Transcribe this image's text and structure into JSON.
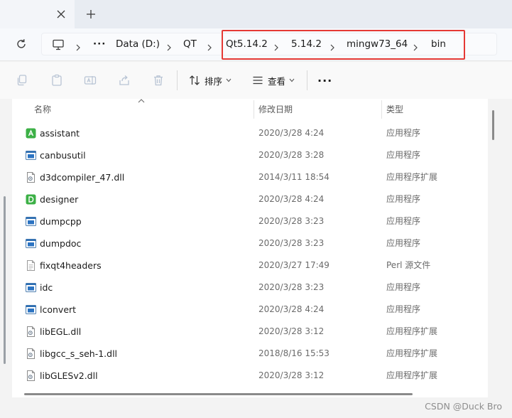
{
  "tabbar": {
    "close_glyph": "×",
    "newtab_glyph": "+"
  },
  "breadcrumb": {
    "items": [
      "Data (D:)",
      "QT",
      "Qt5.14.2",
      "5.14.2",
      "mingw73_64",
      "bin"
    ],
    "overflow": "···"
  },
  "highlight_color": "#e53935",
  "commands": {
    "sort_label": "排序",
    "view_label": "查看",
    "more_label": "···"
  },
  "columns": {
    "name": "名称",
    "modified": "修改日期",
    "type": "类型"
  },
  "files": [
    {
      "name": "assistant",
      "date": "2020/3/28 4:24",
      "type": "应用程序",
      "icon": "app-assistant-icon"
    },
    {
      "name": "canbusutil",
      "date": "2020/3/28 3:28",
      "type": "应用程序",
      "icon": "exe-icon"
    },
    {
      "name": "d3dcompiler_47.dll",
      "date": "2014/3/11 18:54",
      "type": "应用程序扩展",
      "icon": "dll-icon"
    },
    {
      "name": "designer",
      "date": "2020/3/28 4:24",
      "type": "应用程序",
      "icon": "app-designer-icon"
    },
    {
      "name": "dumpcpp",
      "date": "2020/3/28 3:23",
      "type": "应用程序",
      "icon": "exe-icon"
    },
    {
      "name": "dumpdoc",
      "date": "2020/3/28 3:23",
      "type": "应用程序",
      "icon": "exe-icon"
    },
    {
      "name": "fixqt4headers",
      "date": "2020/3/27 17:49",
      "type": "Perl 源文件",
      "icon": "text-file-icon"
    },
    {
      "name": "idc",
      "date": "2020/3/28 3:23",
      "type": "应用程序",
      "icon": "exe-icon"
    },
    {
      "name": "lconvert",
      "date": "2020/3/28 4:24",
      "type": "应用程序",
      "icon": "exe-icon"
    },
    {
      "name": "libEGL.dll",
      "date": "2020/3/28 3:12",
      "type": "应用程序扩展",
      "icon": "dll-icon"
    },
    {
      "name": "libgcc_s_seh-1.dll",
      "date": "2018/8/16 15:53",
      "type": "应用程序扩展",
      "icon": "dll-icon"
    },
    {
      "name": "libGLESv2.dll",
      "date": "2020/3/28 3:12",
      "type": "应用程序扩展",
      "icon": "dll-icon"
    }
  ],
  "watermark": "CSDN @Duck Bro"
}
